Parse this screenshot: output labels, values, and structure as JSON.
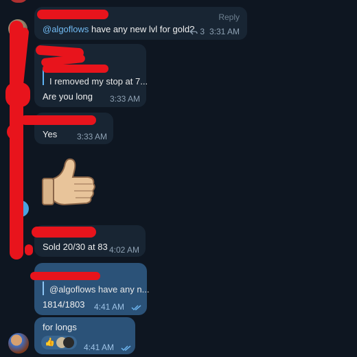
{
  "messages": {
    "m1": {
      "mention": "@algoflows",
      "text": " have any new lvl for gold?",
      "time": "3:31 AM",
      "reply_label": "Reply",
      "reply_count": "3"
    },
    "m2": {
      "quote_text": "I removed my stop at 7...",
      "text": "Are you long",
      "time": "3:33 AM"
    },
    "m3": {
      "text": "Yes",
      "time": "3:33 AM"
    },
    "m4": {
      "sticker": "thumbs-up"
    },
    "m5": {
      "text": "Sold 20/30 at 83",
      "time": "4:02 AM"
    },
    "m6": {
      "quote_text": "@algoflows have any n...",
      "text": "1814/1803",
      "time": "4:41 AM"
    },
    "m7": {
      "text": "for longs",
      "time": "4:41 AM",
      "reaction": "👍"
    }
  },
  "colors": {
    "background": "#0e1621",
    "incoming_bubble": "#182533",
    "outgoing_bubble": "#2b5278",
    "mention": "#71baf2",
    "redaction": "#e8141c"
  }
}
